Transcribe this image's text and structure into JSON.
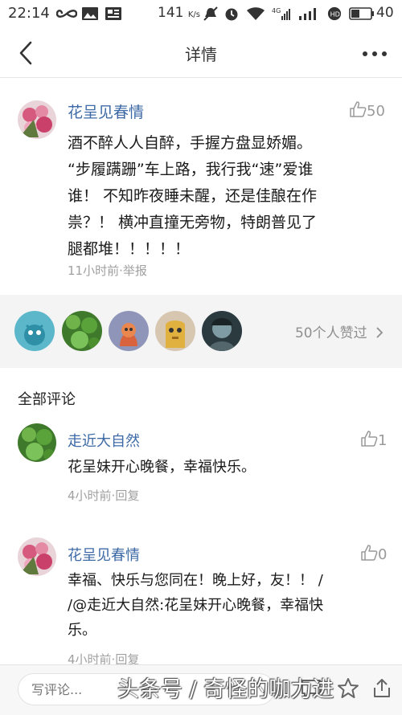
{
  "status_bar": {
    "time": "22:14",
    "speed": "141",
    "speed_unit": "K/s",
    "battery": "40"
  },
  "nav": {
    "title": "详情"
  },
  "post": {
    "author": "花呈见春情",
    "like_count": "50",
    "lines": [
      "酒不醉人人自醉，手握方盘显娇媚。",
      "“步履蹒跚”车上路，我行我“速”爱谁",
      "谁！  不知昨夜睡未醒，还是佳酿在作",
      "祟？！ 横冲直撞无旁物，特朗普见了",
      "腿都堆！！！！！"
    ],
    "time": "11小时前",
    "separator": "·",
    "report": "举报"
  },
  "likers": {
    "summary": "50个人赞过"
  },
  "comments_header": "全部评论",
  "comments": [
    {
      "author": "走近大自然",
      "like_count": "1",
      "lines": [
        "花呈妹开心晚餐，幸福快乐。"
      ],
      "time": "4小时前",
      "separator": "·",
      "reply": "回复"
    },
    {
      "author": "花呈见春情",
      "like_count": "0",
      "lines": [
        "幸福、快乐与您同在！晚上好，友！！ /",
        "/@走近大自然:花呈妹开心晚餐，幸福快",
        "乐。"
      ],
      "time": "4小时前",
      "separator": "·",
      "reply": "回复"
    }
  ],
  "bottom": {
    "placeholder": "写评论...",
    "watermark": "头条号 / 奇怪的咖力进"
  },
  "colors": {
    "author_blue": "#3d6aa6",
    "meta_gray": "#a0a0a0",
    "likers_bg": "#f4f4f4"
  }
}
